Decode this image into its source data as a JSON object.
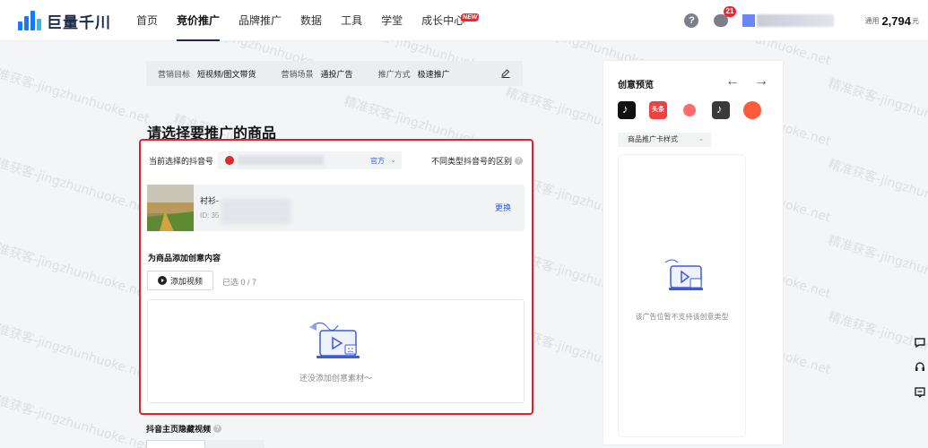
{
  "brand": {
    "name": "巨量千川"
  },
  "nav": {
    "items": [
      {
        "label": "首页"
      },
      {
        "label": "竞价推广"
      },
      {
        "label": "品牌推广"
      },
      {
        "label": "数据"
      },
      {
        "label": "工具"
      },
      {
        "label": "学堂"
      },
      {
        "label": "成长中心"
      }
    ],
    "new_badge": "NEW"
  },
  "top_right": {
    "help": "?",
    "messages_count": "21",
    "balance_label": "通用",
    "balance_value": "2,794",
    "balance_unit": "元"
  },
  "steps": {
    "goal_label": "营销目标",
    "goal_value": "短视频/图文带货",
    "scene_label": "营销场景",
    "scene_value": "通投广告",
    "method_label": "推广方式",
    "method_value": "极速推广"
  },
  "page_title": "请选择要推广的商品",
  "account": {
    "label": "当前选择的抖音号",
    "official_tag": "官方",
    "diff_link": "不同类型抖音号的区别"
  },
  "product": {
    "name": "衬衫-",
    "id": "ID: 35",
    "swap": "更换"
  },
  "creative": {
    "section_label": "为商品添加创意内容",
    "add_video": "添加视频",
    "selected": "已选 0 / 7",
    "empty": "还没添加创意素材～"
  },
  "hidden_video": {
    "label": "抖音主页隐藏视频"
  },
  "preview": {
    "title": "创意预览",
    "toutiao_label": "头条",
    "style_select": "商品推广卡样式",
    "empty": "该广告位暂不支持该创意类型"
  },
  "watermark": "精准获客-jingzhunhuoke.net",
  "colors": {
    "accent_blue": "#2a5fd8",
    "highlight_red": "#e5202d",
    "badge_red": "#f5222d"
  }
}
